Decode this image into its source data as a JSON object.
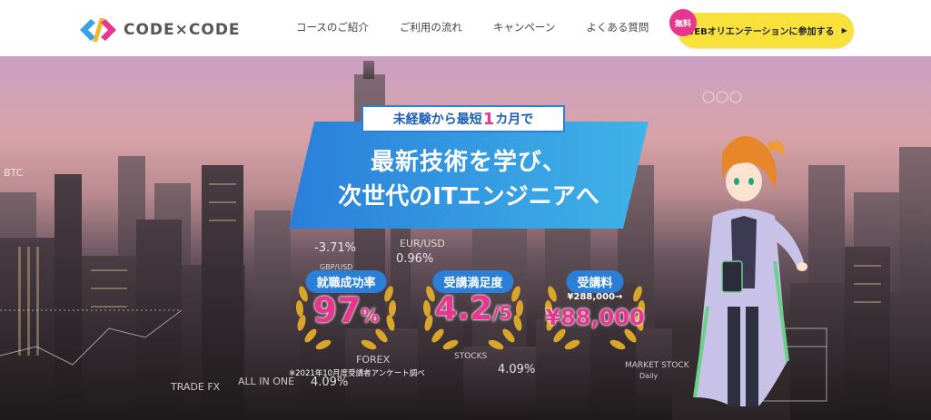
{
  "header": {
    "logo_text": "CODE×CODE",
    "nav": [
      "コースのご紹介",
      "ご利用の流れ",
      "キャンペーン",
      "よくある質問"
    ],
    "cta_badge": "無料",
    "cta_label": "WEBオリエンテーションに参加する",
    "cta_arrow": "▶"
  },
  "hero": {
    "sub_prefix": "未経験から最短",
    "sub_highlight": "1",
    "sub_suffix": "カ月で",
    "title_line1": "最新技術を学び、",
    "title_line2": "次世代のITエンジニアへ",
    "stats": [
      {
        "label": "就職成功率",
        "value": "97",
        "suffix": "%"
      },
      {
        "label": "受講満足度",
        "value": "4.2",
        "suffix": "/5"
      },
      {
        "label": "受講料",
        "old": "¥288,000→",
        "value": "¥88,000",
        "suffix": ""
      }
    ],
    "note": "※2021年10月度受講者アンケート調べ",
    "tickers": [
      "-3.71%",
      "0.96%",
      "EUR/USD",
      "FOREX",
      "TRADE FX",
      "ALL IN ONE",
      "4.09%",
      "4.09%",
      "MARKET STOCK",
      "STOCKS",
      "BTC",
      "GBP/USD",
      "Daily"
    ]
  },
  "colors": {
    "brand_blue": "#2a7fd9",
    "accent_pink": "#e8368f",
    "cta_yellow": "#f8e13a"
  }
}
